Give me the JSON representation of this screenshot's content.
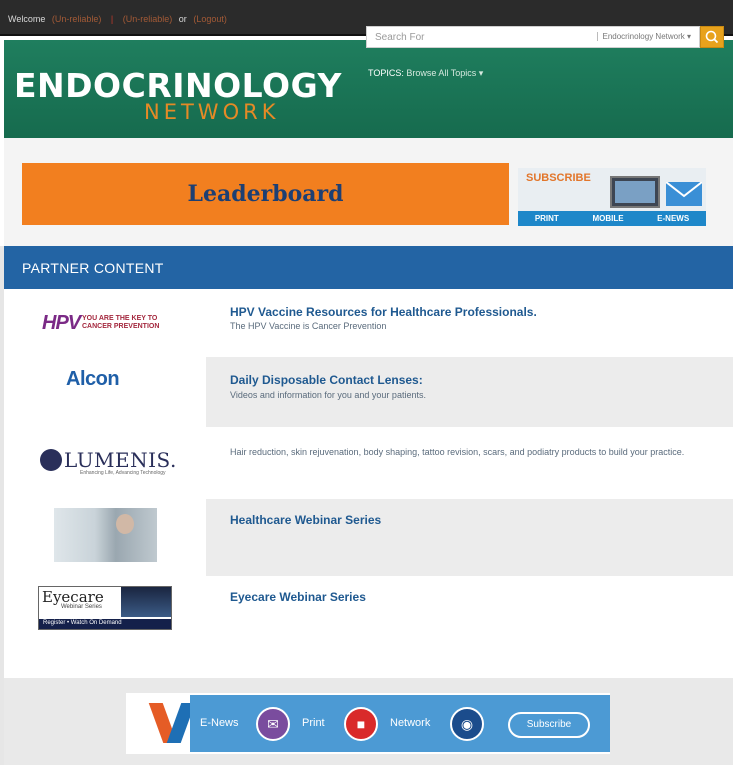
{
  "topbar": {
    "welcome": "Welcome",
    "link_one": "(Un-reliable)",
    "link_two": "(Un-reliable)",
    "or": "or",
    "logout": "(Logout)"
  },
  "brand": {
    "logo_top": "ENDOCRINOLOGY",
    "logo_bottom": "NETWORK",
    "search_placeholder": "Search For",
    "search_scope": "Endocrinology Network ▾",
    "topics_label": "TOPICS:",
    "topics_value": "Browse All Topics ▾"
  },
  "ad": {
    "leaderboard": "Leaderboard"
  },
  "subscribe_ad": {
    "title": "SUBSCRIBE",
    "print": "PRINT",
    "mobile": "MOBILE",
    "enews": "E-NEWS"
  },
  "partner": {
    "header": "PARTNER CONTENT",
    "items": [
      {
        "title": "HPV Vaccine Resources for Healthcare Professionals.",
        "description": "The HPV Vaccine is Cancer Prevention",
        "logo": "HPV",
        "logo_tag_1": "YOU ARE THE KEY TO",
        "logo_tag_2": "CANCER PREVENTION"
      },
      {
        "title": "Daily Disposable Contact Lenses:",
        "description": "Videos and information for you and your patients.",
        "logo": "Alcon"
      },
      {
        "title": "",
        "description": "Hair reduction, skin rejuvenation, body shaping, tattoo revision, scars, and podiatry products to build your practice.",
        "logo": "LUMENIS.",
        "logo_tag": "Enhancing Life, Advancing Technology"
      },
      {
        "title": "Healthcare Webinar Series",
        "description": ""
      },
      {
        "title": "Eyecare Webinar Series",
        "description": "",
        "logo": "Eyecare",
        "logo_sub": "Webinar Series",
        "logo_bar": "Register • Watch On Demand"
      }
    ]
  },
  "footer_bar": {
    "enews": "E-News",
    "print": "Print",
    "network": "Network",
    "subscribe": "Subscribe"
  },
  "colors": {
    "header_green": "#1f7e5e",
    "accent_orange": "#f27f1f",
    "partner_blue": "#2364a4",
    "link_blue": "#1f5990"
  }
}
